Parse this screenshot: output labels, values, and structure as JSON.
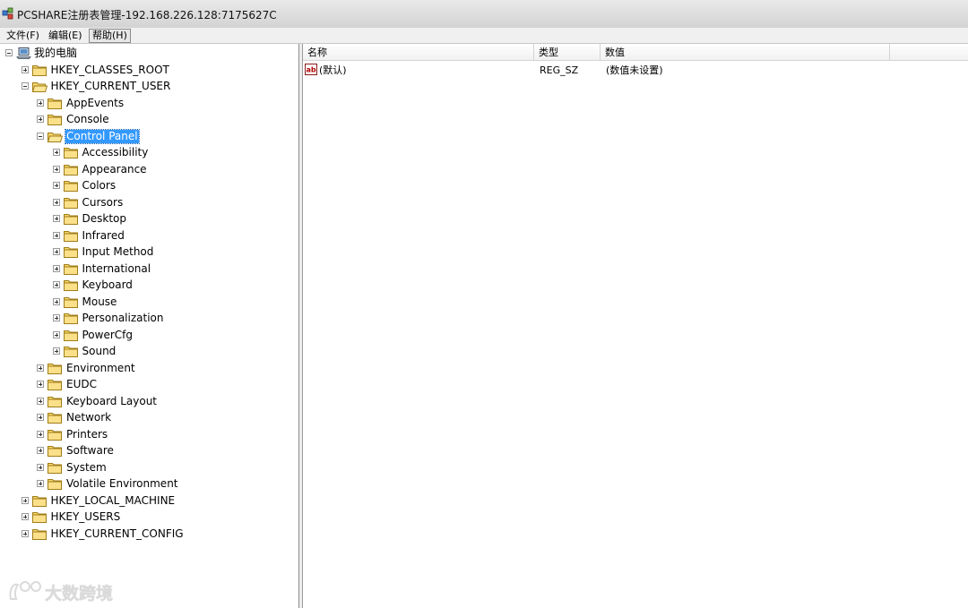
{
  "window": {
    "title": "PCSHARE注册表管理-192.168.226.128:7175627C"
  },
  "menu": {
    "file": "文件(F)",
    "edit": "编辑(E)",
    "help": "帮助(H)"
  },
  "tree": {
    "root": "我的电脑",
    "hkcr": "HKEY_CLASSES_ROOT",
    "hkcu": "HKEY_CURRENT_USER",
    "hkcu_children": [
      "AppEvents",
      "Console",
      "Control Panel"
    ],
    "control_panel_children": [
      "Accessibility",
      "Appearance",
      "Colors",
      "Cursors",
      "Desktop",
      "Infrared",
      "Input Method",
      "International",
      "Keyboard",
      "Mouse",
      "Personalization",
      "PowerCfg",
      "Sound"
    ],
    "hkcu_more": [
      "Environment",
      "EUDC",
      "Keyboard Layout",
      "Network",
      "Printers",
      "Software",
      "System",
      "Volatile Environment"
    ],
    "hives_more": [
      "HKEY_LOCAL_MACHINE",
      "HKEY_USERS",
      "HKEY_CURRENT_CONFIG"
    ],
    "selected": "Control Panel"
  },
  "list": {
    "columns": {
      "name": "名称",
      "type": "类型",
      "data": "数值"
    },
    "rows": [
      {
        "name": "(默认)",
        "type": "REG_SZ",
        "data": "(数值未设置)"
      }
    ]
  },
  "watermark": {
    "text": "大数跨境"
  },
  "colors": {
    "selection": "#3399ff",
    "folder": "#f5d56b"
  }
}
